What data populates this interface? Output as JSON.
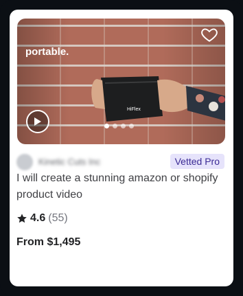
{
  "gig_card": {
    "promo_text": "portable.",
    "seller": {
      "name": "Kinetic Cuts Inc",
      "badge": "Vetted Pro"
    },
    "title": "I will create a stunning amazon or shopify product video",
    "rating": {
      "average": "4.6",
      "count": "(55)"
    },
    "price": "From $1,495",
    "carousel": {
      "total_slides": 4,
      "active_slide": 1
    },
    "colors": {
      "badge_bg": "#e6e3fb",
      "badge_text": "#3b2b94",
      "card_bg": "#ffffff",
      "frame_bg": "#0b0f14"
    },
    "icons": [
      "heart-icon",
      "play-icon",
      "star-icon"
    ]
  }
}
